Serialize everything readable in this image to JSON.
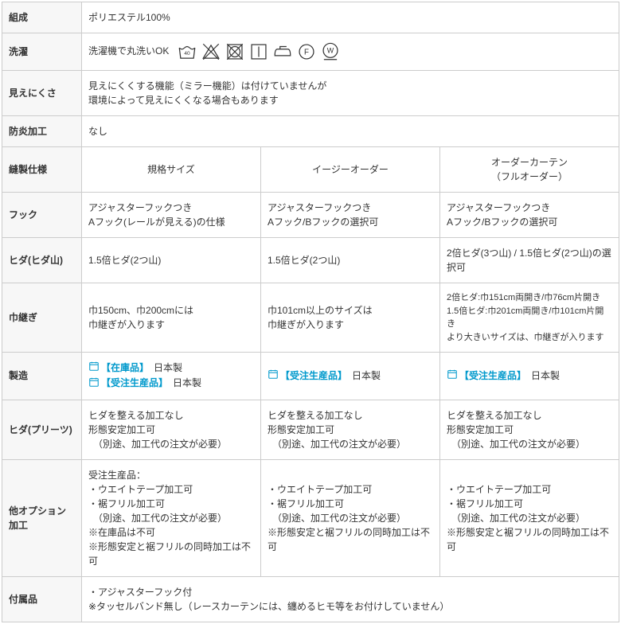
{
  "rows": {
    "composition": {
      "label": "組成",
      "value": "ポリエステル100%"
    },
    "washing": {
      "label": "洗濯",
      "value": "洗濯機で丸洗いOK"
    },
    "visibility": {
      "label": "見えにくさ",
      "line1": "見えにくくする機能（ミラー機能）は付けていませんが",
      "line2": "環境によって見えにくくなる場合もあります"
    },
    "flame": {
      "label": "防炎加工",
      "value": "なし"
    },
    "spec_header": {
      "label": "縫製仕様",
      "col1": "規格サイズ",
      "col2": "イージーオーダー",
      "col3_l1": "オーダーカーテン",
      "col3_l2": "（フルオーダー）"
    },
    "hook": {
      "label": "フック",
      "col1_l1": "アジャスターフックつき",
      "col1_l2": "Aフック(レールが見える)の仕様",
      "col2_l1": "アジャスターフックつき",
      "col2_l2": "Aフック/Bフックの選択可",
      "col3_l1": "アジャスターフックつき",
      "col3_l2": "Aフック/Bフックの選択可"
    },
    "pleat_mount": {
      "label": "ヒダ(ヒダ山)",
      "col1": "1.5倍ヒダ(2つ山)",
      "col2": "1.5倍ヒダ(2つ山)",
      "col3": "2倍ヒダ(3つ山) / 1.5倍ヒダ(2つ山)の選択可"
    },
    "width_join": {
      "label": "巾継ぎ",
      "col1_l1": "巾150cm、巾200cmには",
      "col1_l2": "巾継ぎが入ります",
      "col2_l1": "巾101cm以上のサイズは",
      "col2_l2": "巾継ぎが入ります",
      "col3_l1": "2倍ヒダ:巾151cm両開き/巾76cm片開き",
      "col3_l2": "1.5倍ヒダ:巾201cm両開き/巾101cm片開き",
      "col3_l3": "より大きいサイズは、巾継ぎが入ります"
    },
    "manufacture": {
      "label": "製造",
      "stock": "【在庫品】",
      "made_in": "日本製",
      "made_to_order": "【受注生産品】"
    },
    "pleat_finish": {
      "label": "ヒダ(プリーツ)",
      "l1": "ヒダを整える加工なし",
      "l2": "形態安定加工可",
      "l3": "　（別途、加工代の注文が必要）"
    },
    "options": {
      "label": "他オプション加工",
      "col1_l1": "受注生産品：",
      "col1_l2": "・ウエイトテープ加工可",
      "col1_l3": "・裾フリル加工可",
      "col1_l4": "　（別途、加工代の注文が必要）",
      "col1_l5": "※在庫品は不可",
      "col1_l6": "※形態安定と裾フリルの同時加工は不可",
      "col2_l1": "・ウエイトテープ加工可",
      "col2_l2": "・裾フリル加工可",
      "col2_l3": "　（別途、加工代の注文が必要）",
      "col2_l4": "※形態安定と裾フリルの同時加工は不可",
      "col3_l1": "・ウエイトテープ加工可",
      "col3_l2": "・裾フリル加工可",
      "col3_l3": "　（別途、加工代の注文が必要）",
      "col3_l4": "※形態安定と裾フリルの同時加工は不可"
    },
    "accessories": {
      "label": "付属品",
      "l1": "・アジャスターフック付",
      "l2": "※タッセルバンド無し（レースカーテンには、纏めるヒモ等をお付けしていません）"
    }
  }
}
